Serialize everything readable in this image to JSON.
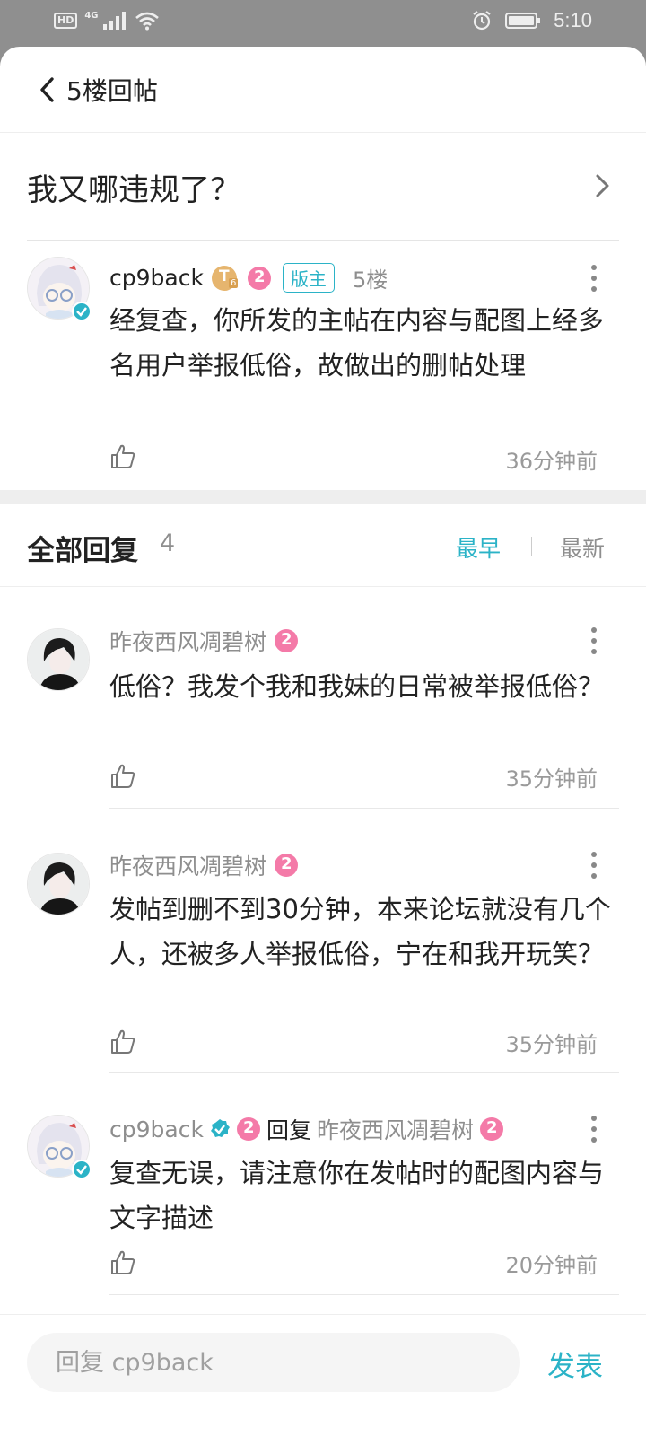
{
  "status_bar": {
    "hd": "HD",
    "network": "4G",
    "time": "5:10"
  },
  "header": {
    "title": "5楼回帖"
  },
  "post": {
    "title": "我又哪违规了？"
  },
  "main_comment": {
    "author": "cp9back",
    "level_badge": "T",
    "level_sub": "6",
    "gender_badge": "2",
    "role_tag": "版主",
    "floor": "5楼",
    "text": "经复查，你所发的主帖在内容与配图上经多名用户举报低俗，故做出的删帖处理",
    "time": "36分钟前"
  },
  "replies_header": {
    "title": "全部回复",
    "count": "4",
    "sort_earliest": "最早",
    "sort_latest": "最新"
  },
  "replies": [
    {
      "author": "昨夜西风凋碧树",
      "badge": "2",
      "text": "低俗？我发个我和我妹的日常被举报低俗？",
      "time": "35分钟前"
    },
    {
      "author": "昨夜西风凋碧树",
      "badge": "2",
      "text": "发帖到删不到30分钟，本来论坛就没有几个人，还被多人举报低俗，宁在和我开玩笑？",
      "time": "35分钟前"
    },
    {
      "author": "cp9back",
      "badge": "2",
      "reply_word": "回复",
      "target": "昨夜西风凋碧树",
      "target_badge": "2",
      "text": "复查无误，请注意你在发帖时的配图内容与文字描述",
      "time": "20分钟前"
    }
  ],
  "bottom_bar": {
    "input_placeholder": "回复 cp9back",
    "publish": "发表"
  },
  "colors": {
    "accent": "#2bb3c7",
    "gender_pink": "#f47aa8",
    "level_gold": "#e6b56e"
  }
}
